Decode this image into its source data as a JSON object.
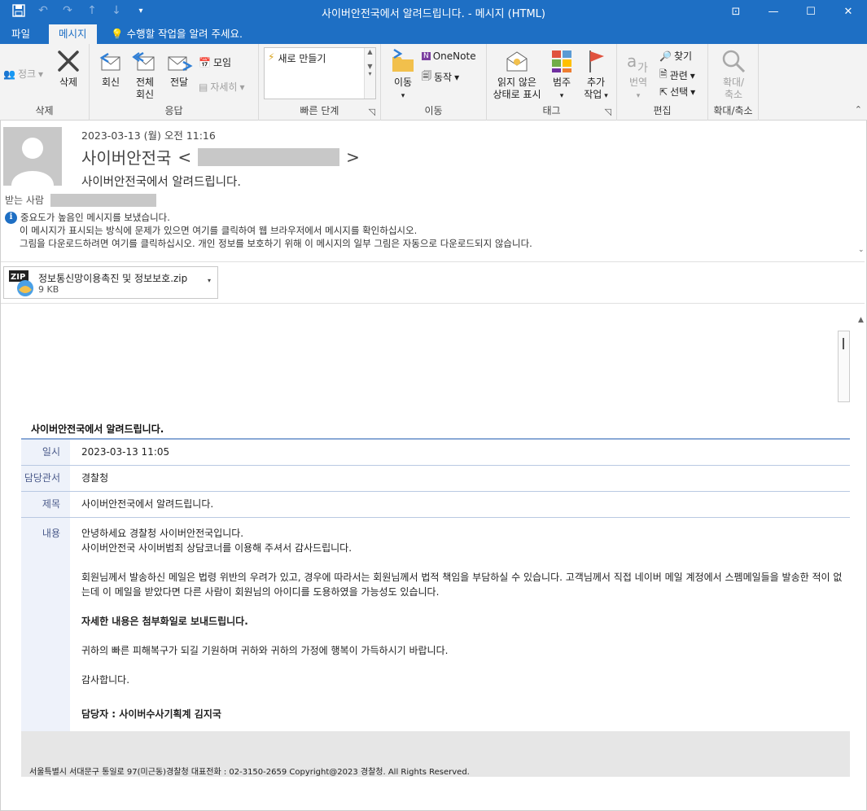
{
  "window": {
    "title": "사이버안전국에서 알려드립니다. - 메시지 (HTML)",
    "qat_icons": [
      "save-icon",
      "undo-icon",
      "redo-icon",
      "up-icon",
      "down-icon",
      "customize-icon"
    ]
  },
  "tabs": {
    "file": "파일",
    "message": "메시지",
    "tell_me": "수행할 작업을 알려 주세요."
  },
  "ribbon": {
    "delete_group": {
      "label": "삭제",
      "junk": "정크",
      "delete": "삭제"
    },
    "respond_group": {
      "label": "응답",
      "reply": "회신",
      "reply_all_1": "전체",
      "reply_all_2": "회신",
      "forward": "전달",
      "meeting": "모임",
      "more": "자세히"
    },
    "quicksteps_group": {
      "label": "빠른 단계",
      "create_new": "새로 만들기"
    },
    "move_group": {
      "label": "이동",
      "move": "이동",
      "onenote": "OneNote",
      "actions": "동작"
    },
    "tags_group": {
      "label": "태그",
      "unread_1": "읽지 않은",
      "unread_2": "상태로 표시",
      "categorize": "범주",
      "followup_1": "추가",
      "followup_2": "작업"
    },
    "editing_group": {
      "label": "편집",
      "translate": "번역",
      "find": "찾기",
      "related": "관련",
      "select": "선택"
    },
    "zoom_group": {
      "label": "확대/축소",
      "zoom_1": "확대/",
      "zoom_2": "축소"
    }
  },
  "header": {
    "date": "2023-03-13 (월) 오전 11:16",
    "sender_name": "사이버안전국",
    "subject": "사이버안전국에서 알려드립니다.",
    "to_label": "받는 사람",
    "info_1": "중요도가 높음인 메시지를 보냈습니다.",
    "info_2": "이 메시지가 표시되는 방식에 문제가 있으면 여기를 클릭하여 웹 브라우저에서 메시지를 확인하십시오.",
    "info_3": "그림을 다운로드하려면 여기를 클릭하십시오. 개인 정보를 보호하기 위해 이 메시지의 일부 그림은 자동으로 다운로드되지 않습니다."
  },
  "attachment": {
    "name": "정보통신망이용촉진 및 정보보호.zip",
    "size": "9 KB"
  },
  "email_body": {
    "title": "사이버안전국에서 알려드립니다.",
    "rows": {
      "date_label": "일시",
      "date_value": "2023-03-13 11:05",
      "dept_label": "담당관서",
      "dept_value": "경찰청",
      "subject_label": "제목",
      "subject_value": "사이버안전국에서 알려드립니다.",
      "content_label": "내용"
    },
    "content": {
      "p1a": "안녕하세요 경찰청 사이버안전국입니다.",
      "p1b": "사이버안전국 사이버범죄 상담코너를 이용해 주셔서 감사드립니다.",
      "p2": "회원님께서 발송하신 메일은 법령 위반의 우려가 있고, 경우에 따라서는 회원님께서 법적 책임을 부담하실 수 있습니다. 고객님께서 직접 네이버 메일 계정에서 스펨메일들을 발송한 적이 없는데 이 메일을 받았다면 다른 사람이 회원님의 아이디를 도용하였을 가능성도 있습니다.",
      "p3": "자세한 내용은 첨부화일로 보내드립니다.",
      "p4": "귀하의 빠른 피해복구가 되길 기원하며 귀하와 귀하의 가정에 행복이 가득하시기 바랍니다.",
      "p5": "감사합니다.",
      "p6": "담당자 : 사이버수사기획계 김지국"
    },
    "footer": "서울특별시 서대문구 통일로 97(미근동)경찰청 대표전화 : 02-3150-2659 Copyright@2023 경찰청. All Rights Reserved."
  },
  "colors": {
    "accent": "#1e6fc4",
    "info": "#1e6fc4",
    "follow_flag": "#e0523e"
  }
}
